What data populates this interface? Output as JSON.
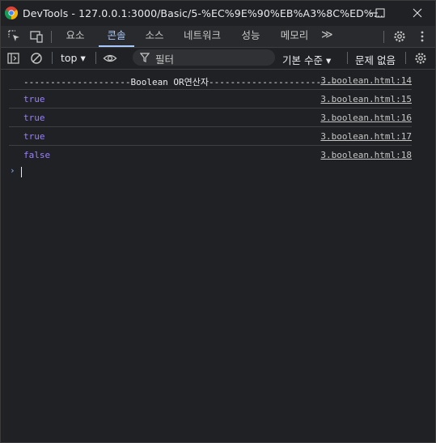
{
  "window": {
    "title": "DevTools - 127.0.0.1:3000/Basic/5-%EC%9E%90%EB%A3%8C%ED%...",
    "minimize_icon": "minimize-icon",
    "maximize_icon": "maximize-icon",
    "close_icon": "close-icon"
  },
  "tabs": [
    {
      "label": "요소"
    },
    {
      "label": "콘솔",
      "active": true
    },
    {
      "label": "소스"
    },
    {
      "label": "네트워크"
    },
    {
      "label": "성능"
    },
    {
      "label": "메모리"
    }
  ],
  "more_tabs": "≫",
  "console_toolbar": {
    "context": "top ▾",
    "filter_placeholder": "필터",
    "levels": "기본 수준 ▾",
    "issues": "문제 없음"
  },
  "console": {
    "rows": [
      {
        "message": "--------------------Boolean OR연산자------------------------",
        "source": "3.boolean.html:14",
        "kind": "text"
      },
      {
        "message": "true",
        "source": "3.boolean.html:15",
        "kind": "bool"
      },
      {
        "message": "true",
        "source": "3.boolean.html:16",
        "kind": "bool"
      },
      {
        "message": "true",
        "source": "3.boolean.html:17",
        "kind": "bool"
      },
      {
        "message": "false",
        "source": "3.boolean.html:18",
        "kind": "bool"
      }
    ],
    "prompt": "›"
  },
  "colors": {
    "background": "#202124",
    "accent": "#a8c7fa",
    "boolean": "#9980ff"
  }
}
